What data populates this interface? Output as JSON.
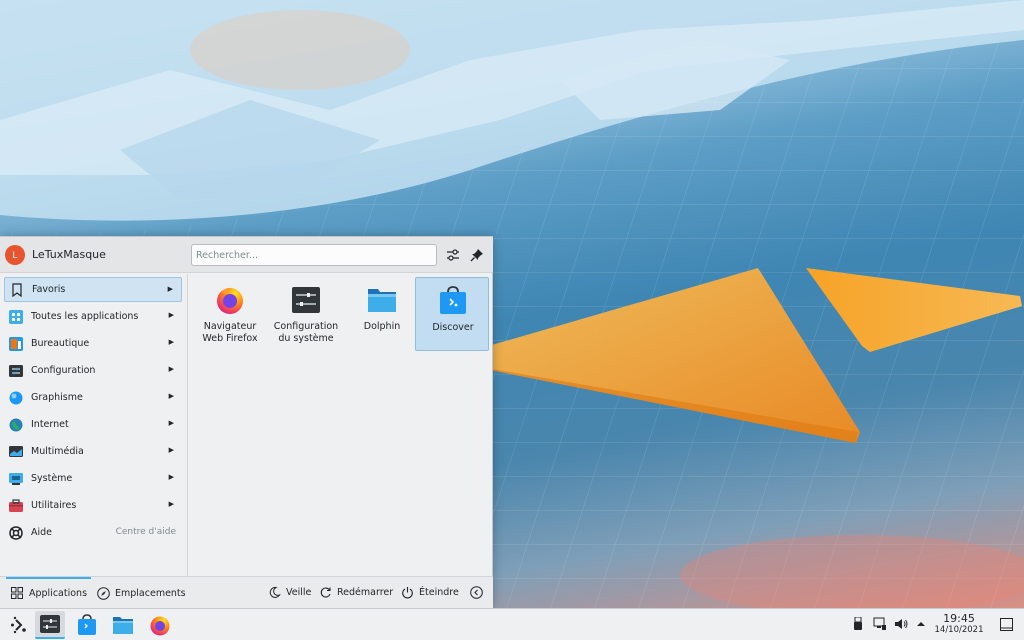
{
  "user": {
    "name": "LeTuxMasque",
    "initial": "L"
  },
  "search": {
    "placeholder": "Rechercher..."
  },
  "categories": [
    {
      "label": "Favoris",
      "icon": "bookmark-icon"
    },
    {
      "label": "Toutes les applications",
      "icon": "grid-apps-icon"
    },
    {
      "label": "Bureautique",
      "icon": "office-icon"
    },
    {
      "label": "Configuration",
      "icon": "settings-icon"
    },
    {
      "label": "Graphisme",
      "icon": "graphics-icon"
    },
    {
      "label": "Internet",
      "icon": "internet-icon"
    },
    {
      "label": "Multimédia",
      "icon": "multimedia-icon"
    },
    {
      "label": "Système",
      "icon": "system-icon"
    },
    {
      "label": "Utilitaires",
      "icon": "utilities-icon"
    },
    {
      "label": "Aide",
      "icon": "help-icon",
      "sub": "Centre d'aide"
    }
  ],
  "apps": [
    {
      "line1": "Navigateur",
      "line2": "Web Firefox",
      "icon": "firefox-icon"
    },
    {
      "line1": "Configuration",
      "line2": "du système",
      "icon": "system-settings-icon"
    },
    {
      "line1": "Dolphin",
      "line2": "",
      "icon": "folder-icon"
    },
    {
      "line1": "Discover",
      "line2": "",
      "icon": "discover-icon"
    }
  ],
  "footer": {
    "tab_applications": "Applications",
    "tab_places": "Emplacements",
    "sleep": "Veille",
    "restart": "Redémarrer",
    "shutdown": "Éteindre"
  },
  "clock": {
    "time": "19:45",
    "date": "14/10/2021"
  },
  "colors": {
    "accent": "#3daee9",
    "avatar": "#e8542e"
  }
}
